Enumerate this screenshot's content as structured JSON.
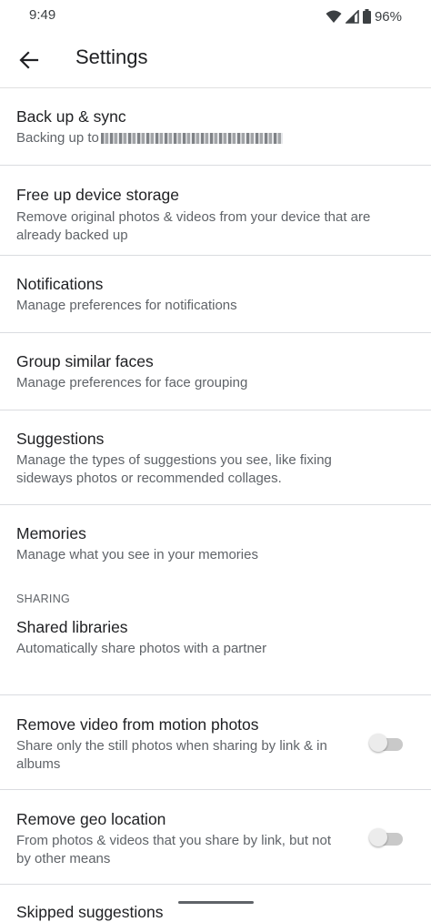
{
  "status_bar": {
    "time": "9:49",
    "battery": "96%",
    "icons": [
      "wifi-icon",
      "cell-signal-icon",
      "battery-icon"
    ]
  },
  "appbar": {
    "title": "Settings",
    "back_icon": "arrow-back-icon"
  },
  "items": [
    {
      "title": "Back up & sync",
      "subtitle": "Backing up to"
    },
    {
      "title": "Free up device storage",
      "subtitle": "Remove original photos & videos from your device that are already backed up"
    },
    {
      "title": "Notifications",
      "subtitle": "Manage preferences for notifications"
    },
    {
      "title": "Group similar faces",
      "subtitle": "Manage preferences for face grouping"
    },
    {
      "title": "Suggestions",
      "subtitle": "Manage the types of suggestions you see, like fixing sideways photos or recommended collages."
    },
    {
      "title": "Memories",
      "subtitle": "Manage what you see in your memories"
    }
  ],
  "sharing_section": {
    "header": "SHARING",
    "items": [
      {
        "title": "Shared libraries",
        "subtitle": "Automatically share photos with a partner"
      },
      {
        "title": "Remove video from motion photos",
        "subtitle": "Share only the still photos when sharing by link & in albums",
        "toggle_on": false
      },
      {
        "title": "Remove geo location",
        "subtitle": "From photos & videos that you share by link, but not by other means",
        "toggle_on": false
      },
      {
        "title": "Skipped suggestions"
      }
    ]
  },
  "colors": {
    "text_primary": "#202124",
    "text_secondary": "#5f6368",
    "divider": "#dadce0",
    "toggle_off_track": "#c9c9c9"
  }
}
